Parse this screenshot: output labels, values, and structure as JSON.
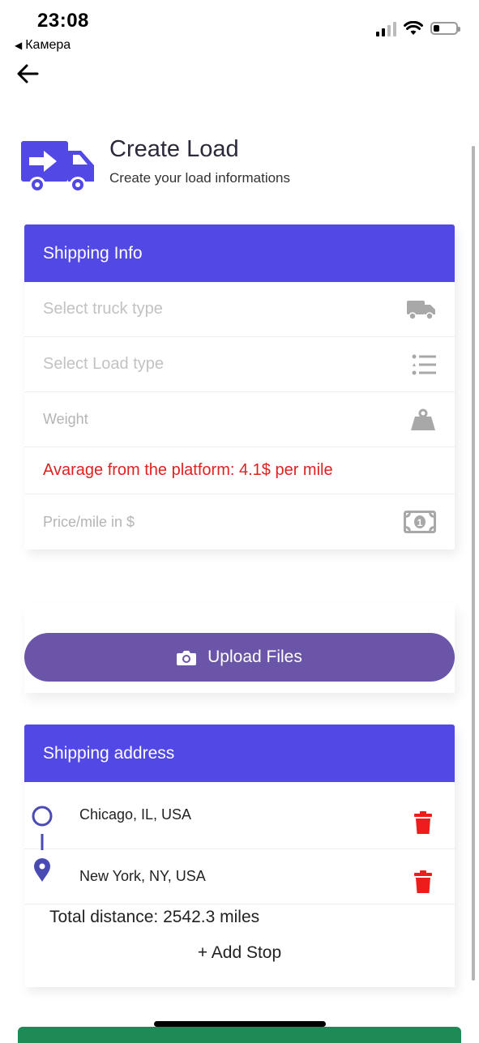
{
  "status": {
    "time": "23:08",
    "back_app": "Камера"
  },
  "header": {
    "title": "Create Load",
    "subtitle": "Create your load informations"
  },
  "shipping_info": {
    "title": "Shipping Info",
    "truck_placeholder": "Select truck type",
    "load_placeholder": "Select Load type",
    "weight_placeholder": "Weight",
    "avg_notice": "Avarage from the platform: 4.1$ per mile",
    "price_placeholder": "Price/mile in $"
  },
  "upload": {
    "label": "Upload Files"
  },
  "shipping_address": {
    "title": "Shipping address",
    "stops": [
      {
        "name": "Chicago, IL, USA"
      },
      {
        "name": "New York, NY, USA"
      }
    ],
    "total_distance": "Total distance: 2542.3 miles",
    "add_stop": "+ Add Stop"
  },
  "colors": {
    "accent": "#5148e6",
    "upload": "#6b55a8",
    "danger": "#e0201e",
    "primary_action": "#1e8a55"
  }
}
